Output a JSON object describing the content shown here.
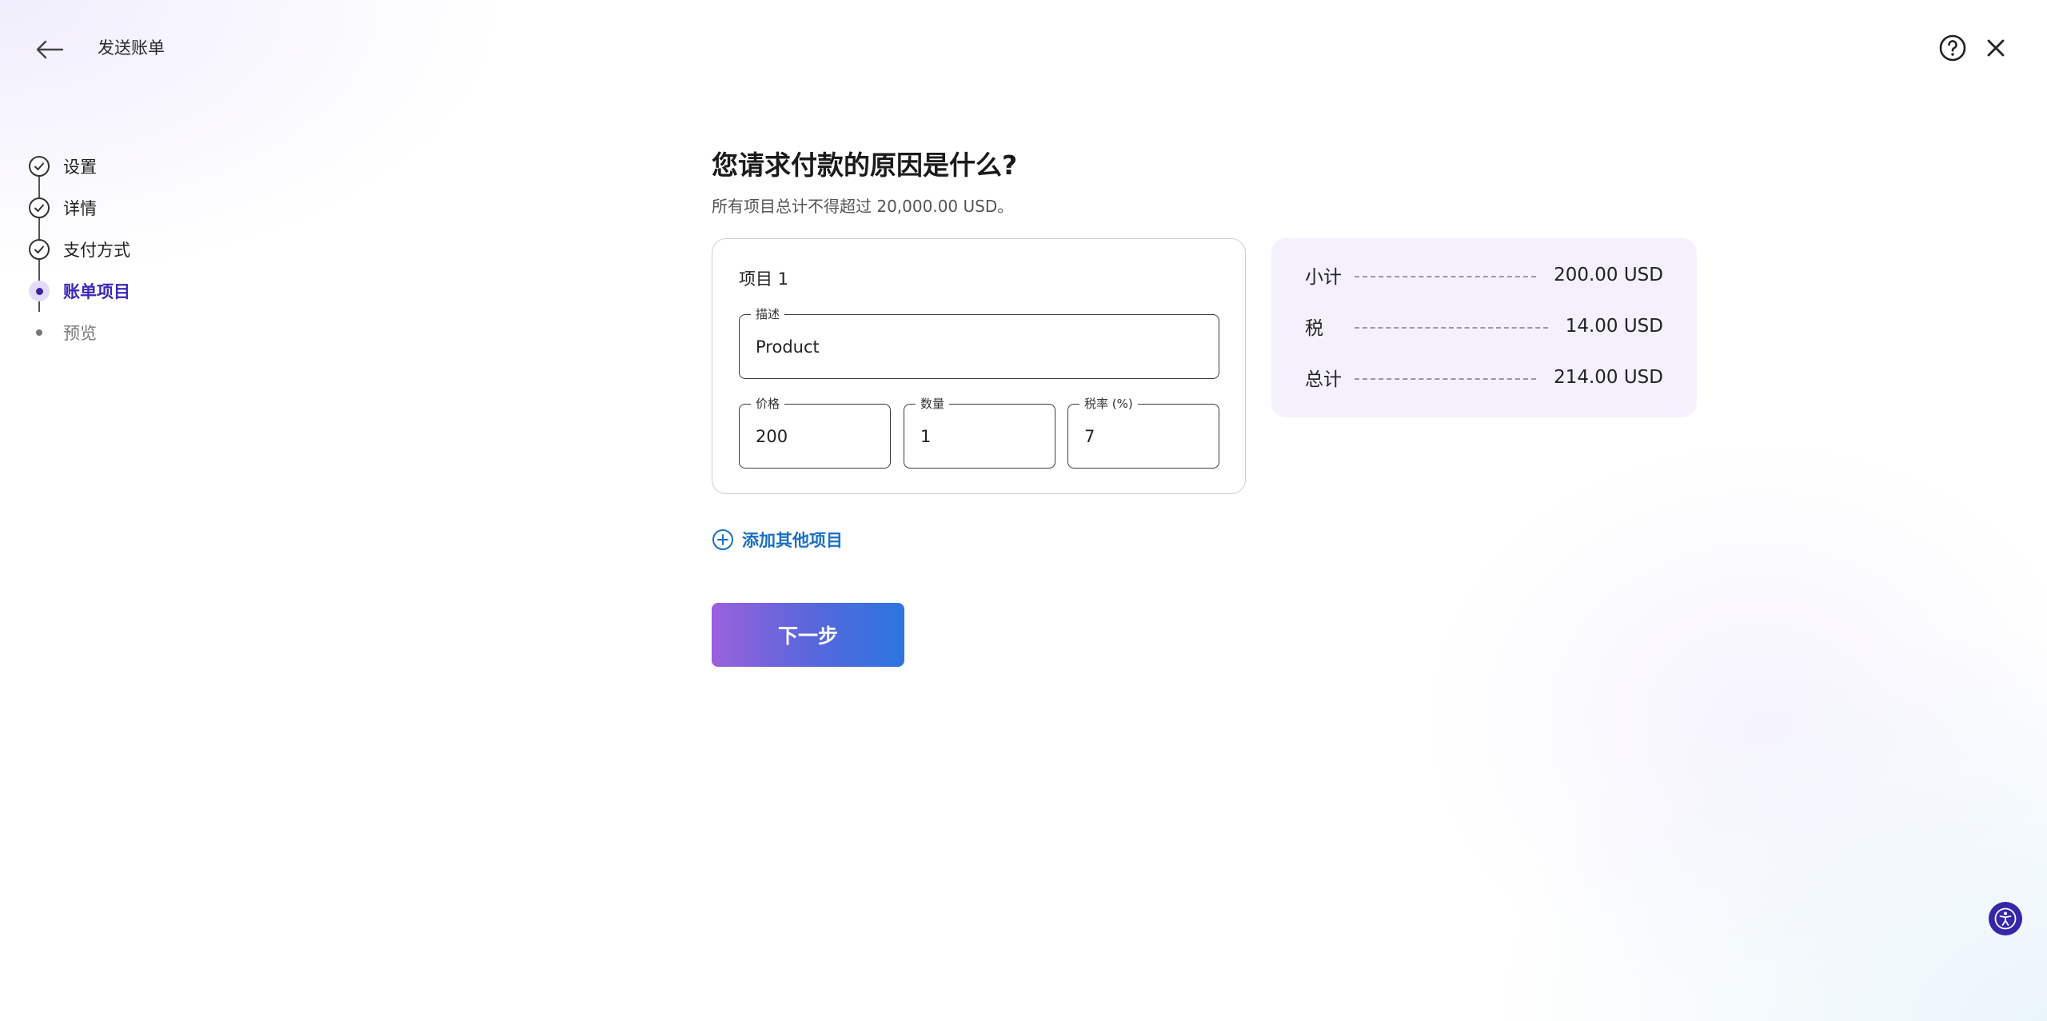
{
  "header": {
    "title": "发送账单"
  },
  "stepper": {
    "steps": [
      {
        "label": "设置",
        "state": "done"
      },
      {
        "label": "详情",
        "state": "done"
      },
      {
        "label": "支付方式",
        "state": "done"
      },
      {
        "label": "账单项目",
        "state": "active"
      },
      {
        "label": "预览",
        "state": "pending"
      }
    ]
  },
  "main": {
    "question": "您请求付款的原因是什么?",
    "subtext": "所有项目总计不得超过 20,000.00 USD。"
  },
  "item": {
    "title": "项目 1",
    "description_label": "描述",
    "description_value": "Product",
    "price_label": "价格",
    "price_value": "200",
    "quantity_label": "数量",
    "quantity_value": "1",
    "tax_label": "税率 (%)",
    "tax_value": "7"
  },
  "summary": {
    "subtotal_label": "小计",
    "subtotal_value": "200.00 USD",
    "tax_label": "税",
    "tax_value": "14.00 USD",
    "total_label": "总计",
    "total_value": "214.00 USD"
  },
  "actions": {
    "add_item_label": "添加其他项目",
    "next_label": "下一步"
  },
  "colors": {
    "accent": "#3b28b5",
    "link": "#1a6fc4",
    "summary_bg": "#f4f1fd"
  },
  "icons": {
    "back": "arrow-left-icon",
    "help": "question-circle-icon",
    "close": "close-icon",
    "add": "plus-circle-icon",
    "accessibility": "accessibility-icon",
    "step_done": "check-circle-icon"
  }
}
